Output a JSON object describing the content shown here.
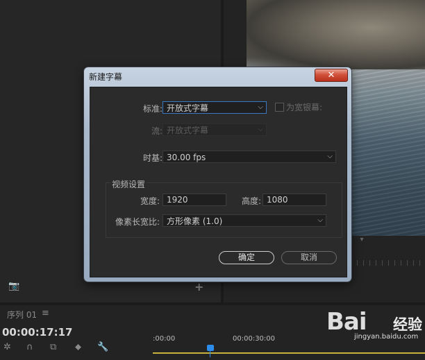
{
  "dialog": {
    "title": "新建字幕",
    "close_glyph": "✕",
    "standard_label": "标准:",
    "standard_value": "开放式字幕",
    "widescreen_label": "为宽银幕:",
    "stream_label": "流:",
    "stream_value": "开放式字幕",
    "timebase_label": "时基:",
    "timebase_value": "30.00 fps",
    "video_settings_title": "视频设置",
    "width_label": "宽度:",
    "width_value": "1920",
    "height_label": "高度:",
    "height_value": "1080",
    "pixel_aspect_label": "像素长宽比:",
    "pixel_aspect_value": "方形像素 (1.0)",
    "ok_label": "确定",
    "cancel_label": "取消"
  },
  "sequence": {
    "tab_label": "序列 01",
    "menu_glyph": "≡",
    "timecode": "00:00:17:17",
    "ruler_start": ":00:00",
    "ruler_mid": "00:00:30:00"
  },
  "icons": {
    "camera": "camera-icon",
    "add": "plus-icon",
    "chevron": "chevron-down-icon"
  },
  "watermark": {
    "logo_text": "Bai",
    "brand_text": "经验",
    "url": "jingyan.baidu.com"
  },
  "colors": {
    "focus_border": "#3a78c2",
    "playhead": "#2d8ceb",
    "timeline_bar": "#c8b23c",
    "close_button": "#d2523c"
  }
}
